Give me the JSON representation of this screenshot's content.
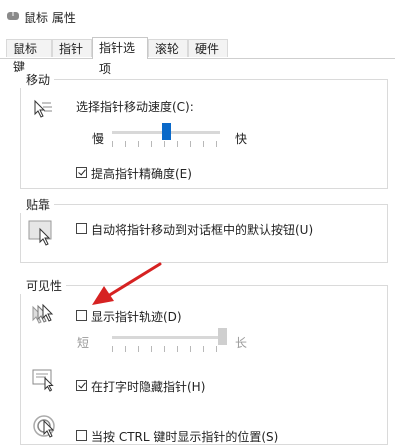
{
  "window": {
    "title": "鼠标 属性"
  },
  "tabs": [
    {
      "label": "鼠标键"
    },
    {
      "label": "指针"
    },
    {
      "label": "指针选项"
    },
    {
      "label": "滚轮"
    },
    {
      "label": "硬件"
    }
  ],
  "active_tab_index": 2,
  "motion": {
    "title": "移动",
    "speed_label": "选择指针移动速度(C):",
    "slow_label": "慢",
    "fast_label": "快",
    "speed_level": 0.5,
    "precision_label": "提高指针精确度(E)",
    "precision_checked": true
  },
  "snap": {
    "title": "贴靠",
    "label": "自动将指针移动到对话框中的默认按钮(U)",
    "checked": false
  },
  "visibility": {
    "title": "可见性",
    "trails_label": "显示指针轨迹(D)",
    "trails_checked": false,
    "short_label": "短",
    "long_label": "长",
    "trails_level": 1.0,
    "hide_typing_label": "在打字时隐藏指针(H)",
    "hide_typing_checked": true,
    "ctrl_label": "当按 CTRL 键时显示指针的位置(S)",
    "ctrl_checked": false
  },
  "colors": {
    "accent": "#0a69c9",
    "annotation_arrow": "#d62222"
  }
}
